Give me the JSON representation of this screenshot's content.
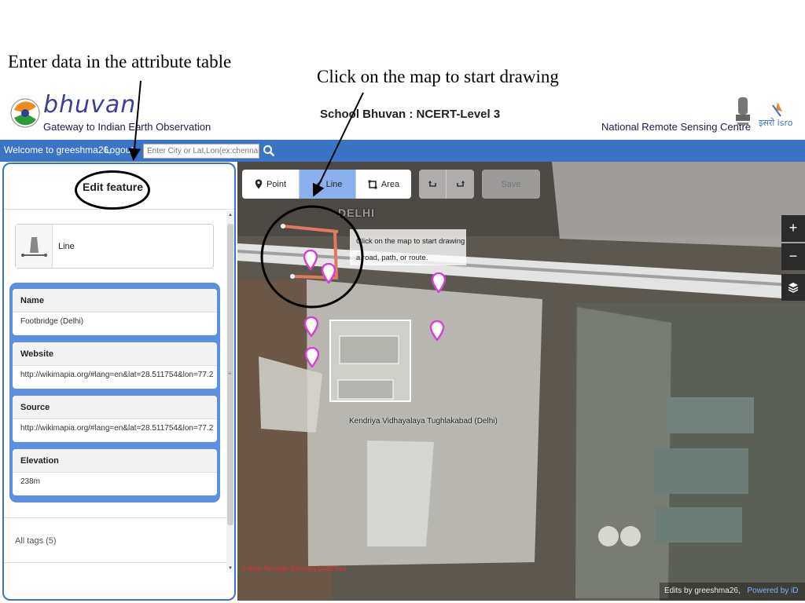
{
  "annotations": {
    "left": "Enter data in the attribute table",
    "right": "Click on the map to start drawing"
  },
  "header": {
    "brand": "bhuvan",
    "tagline": "Gateway to Indian Earth Observation",
    "center_title": "School Bhuvan : NCERT-Level 3",
    "org": "National Remote Sensing Centre"
  },
  "topbar": {
    "welcome": "Welcome to greeshma26,",
    "logout": "Logout",
    "search_placeholder": "Enter City or Lat,Lon(ex:chennai or"
  },
  "sidebar": {
    "title": "Edit feature",
    "preset_label": "Line",
    "fields": [
      {
        "label": "Name",
        "value": "Footbridge (Delhi)"
      },
      {
        "label": "Website",
        "value": "http://wikimapia.org/#lang=en&lat=28.511754&lon=77.2..."
      },
      {
        "label": "Source",
        "value": "http://wikimapia.org/#lang=en&lat=28.511754&lon=77.2..."
      },
      {
        "label": "Elevation",
        "value": "238m"
      }
    ],
    "tags_label": "All tags (5)"
  },
  "toolbar": {
    "point": "Point",
    "line": "Line",
    "area": "Area",
    "save": "Save"
  },
  "map": {
    "tooltip_line1": "Click on the map to start drawing",
    "tooltip_line2": "a road, path, or route.",
    "delhi_label": "DELHI",
    "school_label": "Kendriya Vidhayalaya Tughlakabad (Delhi)",
    "attribution": "Indian Remote Sensing Satellites",
    "edits_by": "Edits by greeshma26,",
    "powered_by": "Powered by iD",
    "zoom_in": "+",
    "zoom_out": "−"
  },
  "colors": {
    "topbar": "#3b74c4",
    "fields_panel": "#5b8fe0",
    "active_tool": "#8ab0ee",
    "marker": "#d63fd8"
  },
  "icons": [
    "search-icon",
    "point-icon",
    "line-icon",
    "area-icon",
    "undo-icon",
    "redo-icon",
    "layers-icon",
    "zoom-in-icon",
    "zoom-out-icon",
    "bhuvan-logo",
    "national-emblem",
    "isro-logo"
  ]
}
